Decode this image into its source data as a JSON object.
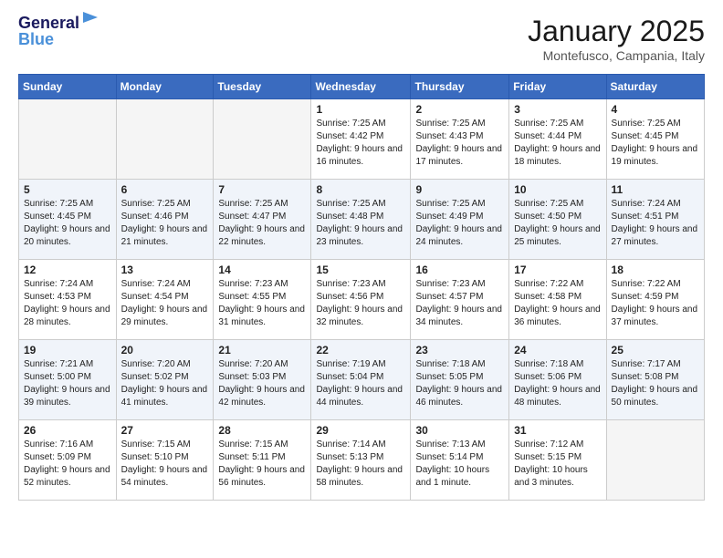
{
  "header": {
    "logo_line1": "General",
    "logo_line2": "Blue",
    "title": "January 2025",
    "subtitle": "Montefusco, Campania, Italy"
  },
  "weekdays": [
    "Sunday",
    "Monday",
    "Tuesday",
    "Wednesday",
    "Thursday",
    "Friday",
    "Saturday"
  ],
  "weeks": [
    [
      {
        "day": "",
        "info": ""
      },
      {
        "day": "",
        "info": ""
      },
      {
        "day": "",
        "info": ""
      },
      {
        "day": "1",
        "info": "Sunrise: 7:25 AM\nSunset: 4:42 PM\nDaylight: 9 hours and 16 minutes."
      },
      {
        "day": "2",
        "info": "Sunrise: 7:25 AM\nSunset: 4:43 PM\nDaylight: 9 hours and 17 minutes."
      },
      {
        "day": "3",
        "info": "Sunrise: 7:25 AM\nSunset: 4:44 PM\nDaylight: 9 hours and 18 minutes."
      },
      {
        "day": "4",
        "info": "Sunrise: 7:25 AM\nSunset: 4:45 PM\nDaylight: 9 hours and 19 minutes."
      }
    ],
    [
      {
        "day": "5",
        "info": "Sunrise: 7:25 AM\nSunset: 4:45 PM\nDaylight: 9 hours and 20 minutes."
      },
      {
        "day": "6",
        "info": "Sunrise: 7:25 AM\nSunset: 4:46 PM\nDaylight: 9 hours and 21 minutes."
      },
      {
        "day": "7",
        "info": "Sunrise: 7:25 AM\nSunset: 4:47 PM\nDaylight: 9 hours and 22 minutes."
      },
      {
        "day": "8",
        "info": "Sunrise: 7:25 AM\nSunset: 4:48 PM\nDaylight: 9 hours and 23 minutes."
      },
      {
        "day": "9",
        "info": "Sunrise: 7:25 AM\nSunset: 4:49 PM\nDaylight: 9 hours and 24 minutes."
      },
      {
        "day": "10",
        "info": "Sunrise: 7:25 AM\nSunset: 4:50 PM\nDaylight: 9 hours and 25 minutes."
      },
      {
        "day": "11",
        "info": "Sunrise: 7:24 AM\nSunset: 4:51 PM\nDaylight: 9 hours and 27 minutes."
      }
    ],
    [
      {
        "day": "12",
        "info": "Sunrise: 7:24 AM\nSunset: 4:53 PM\nDaylight: 9 hours and 28 minutes."
      },
      {
        "day": "13",
        "info": "Sunrise: 7:24 AM\nSunset: 4:54 PM\nDaylight: 9 hours and 29 minutes."
      },
      {
        "day": "14",
        "info": "Sunrise: 7:23 AM\nSunset: 4:55 PM\nDaylight: 9 hours and 31 minutes."
      },
      {
        "day": "15",
        "info": "Sunrise: 7:23 AM\nSunset: 4:56 PM\nDaylight: 9 hours and 32 minutes."
      },
      {
        "day": "16",
        "info": "Sunrise: 7:23 AM\nSunset: 4:57 PM\nDaylight: 9 hours and 34 minutes."
      },
      {
        "day": "17",
        "info": "Sunrise: 7:22 AM\nSunset: 4:58 PM\nDaylight: 9 hours and 36 minutes."
      },
      {
        "day": "18",
        "info": "Sunrise: 7:22 AM\nSunset: 4:59 PM\nDaylight: 9 hours and 37 minutes."
      }
    ],
    [
      {
        "day": "19",
        "info": "Sunrise: 7:21 AM\nSunset: 5:00 PM\nDaylight: 9 hours and 39 minutes."
      },
      {
        "day": "20",
        "info": "Sunrise: 7:20 AM\nSunset: 5:02 PM\nDaylight: 9 hours and 41 minutes."
      },
      {
        "day": "21",
        "info": "Sunrise: 7:20 AM\nSunset: 5:03 PM\nDaylight: 9 hours and 42 minutes."
      },
      {
        "day": "22",
        "info": "Sunrise: 7:19 AM\nSunset: 5:04 PM\nDaylight: 9 hours and 44 minutes."
      },
      {
        "day": "23",
        "info": "Sunrise: 7:18 AM\nSunset: 5:05 PM\nDaylight: 9 hours and 46 minutes."
      },
      {
        "day": "24",
        "info": "Sunrise: 7:18 AM\nSunset: 5:06 PM\nDaylight: 9 hours and 48 minutes."
      },
      {
        "day": "25",
        "info": "Sunrise: 7:17 AM\nSunset: 5:08 PM\nDaylight: 9 hours and 50 minutes."
      }
    ],
    [
      {
        "day": "26",
        "info": "Sunrise: 7:16 AM\nSunset: 5:09 PM\nDaylight: 9 hours and 52 minutes."
      },
      {
        "day": "27",
        "info": "Sunrise: 7:15 AM\nSunset: 5:10 PM\nDaylight: 9 hours and 54 minutes."
      },
      {
        "day": "28",
        "info": "Sunrise: 7:15 AM\nSunset: 5:11 PM\nDaylight: 9 hours and 56 minutes."
      },
      {
        "day": "29",
        "info": "Sunrise: 7:14 AM\nSunset: 5:13 PM\nDaylight: 9 hours and 58 minutes."
      },
      {
        "day": "30",
        "info": "Sunrise: 7:13 AM\nSunset: 5:14 PM\nDaylight: 10 hours and 1 minute."
      },
      {
        "day": "31",
        "info": "Sunrise: 7:12 AM\nSunset: 5:15 PM\nDaylight: 10 hours and 3 minutes."
      },
      {
        "day": "",
        "info": ""
      }
    ]
  ]
}
